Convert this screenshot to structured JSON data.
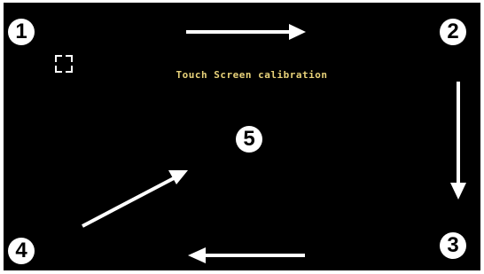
{
  "screen": {
    "title": "Touch Screen calibration",
    "colors": {
      "background": "#000000",
      "title": "#e8d27a",
      "marks": "#ffffff"
    }
  },
  "steps": [
    "1",
    "2",
    "3",
    "4",
    "5"
  ],
  "icons": {
    "target": "crosshair-target-icon",
    "arrow_1_2": "arrow-right-icon",
    "arrow_2_3": "arrow-down-icon",
    "arrow_3_4": "arrow-left-icon",
    "arrow_4_5": "arrow-up-right-icon"
  }
}
